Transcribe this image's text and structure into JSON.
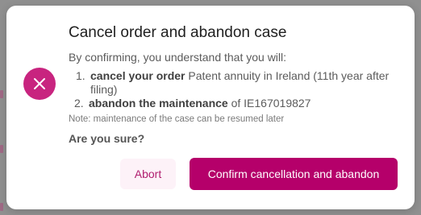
{
  "colors": {
    "accent": "#b5006a",
    "danger_icon_bg": "#c8247f",
    "abort_bg": "#fdf2f8",
    "abort_text": "#b01e6f"
  },
  "dialog": {
    "icon": "close-icon",
    "title": "Cancel order and abandon case",
    "lead": "By confirming, you understand that you will:",
    "consequences": [
      {
        "number": "1.",
        "action": "cancel your order",
        "detail": "Patent annuity in Ireland (11th year after filing)"
      },
      {
        "number": "2.",
        "action": "abandon the maintenance",
        "detail": "of IE167019827"
      }
    ],
    "note": "Note: maintenance of the case can be resumed later",
    "question": "Are you sure?",
    "abort_label": "Abort",
    "confirm_label": "Confirm cancellation and abandon"
  }
}
